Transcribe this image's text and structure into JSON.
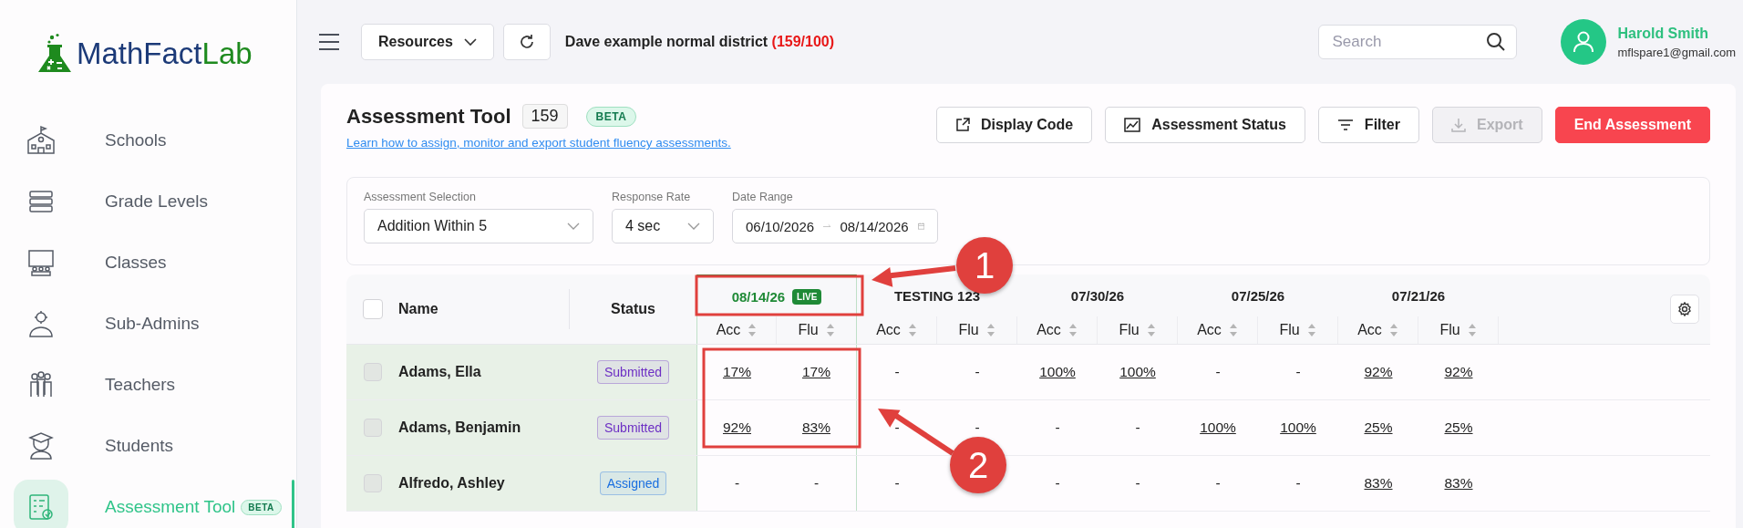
{
  "logo": {
    "part_1": "MathFact",
    "part_2": "Lab"
  },
  "sidebar": {
    "items": [
      {
        "label": "Schools",
        "kind": "school",
        "selected": false
      },
      {
        "label": "Grade Levels",
        "kind": "levels",
        "selected": false
      },
      {
        "label": "Classes",
        "kind": "classroom",
        "selected": false
      },
      {
        "label": "Sub-Admins",
        "kind": "admin",
        "selected": false
      },
      {
        "label": "Teachers",
        "kind": "teachers",
        "selected": false
      },
      {
        "label": "Students",
        "kind": "student",
        "selected": false
      },
      {
        "label": "Assessment Tool",
        "kind": "assessment",
        "selected": true,
        "badge": "BETA"
      }
    ]
  },
  "topbar": {
    "resources": "Resources",
    "district": "Dave example normal district",
    "district_count": "(159/100)",
    "search": {
      "placeholder": "Search"
    },
    "user": {
      "name": "Harold Smith",
      "email": "mflspare1@gmail.com"
    }
  },
  "page": {
    "title": "Assessment Tool",
    "count": "159",
    "badge": "BETA",
    "help_link": "Learn how to assign, monitor and export student fluency assessments.",
    "buttons": [
      {
        "label": "Display Code",
        "kind": "display",
        "disabled": false
      },
      {
        "label": "Assessment Status",
        "kind": "status",
        "disabled": false
      },
      {
        "label": "Filter",
        "kind": "filter",
        "disabled": false
      },
      {
        "label": "Export",
        "kind": "export",
        "disabled": true
      },
      {
        "label": "End Assessment",
        "kind": "end",
        "disabled": false
      }
    ]
  },
  "filters": {
    "assessment_selection": {
      "label": "Assessment Selection",
      "value": "Addition Within 5"
    },
    "response_rate": {
      "label": "Response Rate",
      "value": "4 sec"
    },
    "date_range": {
      "label": "Date Range",
      "start": "06/10/2026",
      "end": "08/14/2026"
    }
  },
  "table": {
    "select_all": {
      "checked": false
    },
    "columns": {
      "name": "Name",
      "status": "Status"
    },
    "sessions": [
      {
        "title": "08/14/26",
        "live": true,
        "live_label": "LIVE",
        "sub": [
          "Acc",
          "Flu"
        ]
      },
      {
        "title": "TESTING 123",
        "live": false,
        "sub": [
          "Acc",
          "Flu"
        ]
      },
      {
        "title": "07/30/26",
        "live": false,
        "sub": [
          "Acc",
          "Flu"
        ]
      },
      {
        "title": "07/25/26",
        "live": false,
        "sub": [
          "Acc",
          "Flu"
        ]
      },
      {
        "title": "07/21/26",
        "live": false,
        "sub": [
          "Acc",
          "Flu"
        ]
      }
    ],
    "rows": [
      {
        "checked": false,
        "name": "Adams, Ella",
        "status": {
          "label": "Submitted",
          "color": "#6d2fc4"
        },
        "cells": [
          {
            "text": "17%",
            "link": true
          },
          {
            "text": "17%",
            "link": true
          },
          {
            "text": "-",
            "link": false
          },
          {
            "text": "-",
            "link": false
          },
          {
            "text": "100%",
            "link": true
          },
          {
            "text": "100%",
            "link": true
          },
          {
            "text": "-",
            "link": false
          },
          {
            "text": "-",
            "link": false
          },
          {
            "text": "92%",
            "link": true
          },
          {
            "text": "92%",
            "link": true
          }
        ]
      },
      {
        "checked": false,
        "name": "Adams, Benjamin",
        "status": {
          "label": "Submitted",
          "color": "#6d2fc4"
        },
        "cells": [
          {
            "text": "92%",
            "link": true
          },
          {
            "text": "83%",
            "link": true
          },
          {
            "text": "-",
            "link": false
          },
          {
            "text": "-",
            "link": false
          },
          {
            "text": "-",
            "link": false
          },
          {
            "text": "-",
            "link": false
          },
          {
            "text": "100%",
            "link": true
          },
          {
            "text": "100%",
            "link": true
          },
          {
            "text": "25%",
            "link": true
          },
          {
            "text": "25%",
            "link": true
          }
        ]
      },
      {
        "checked": false,
        "name": "Alfredo, Ashley",
        "status": {
          "label": "Assigned",
          "color": "#1a6fe0"
        },
        "cells": [
          {
            "text": "-",
            "link": false
          },
          {
            "text": "-",
            "link": false
          },
          {
            "text": "-",
            "link": false
          },
          null,
          {
            "text": "-",
            "link": false
          },
          {
            "text": "-",
            "link": false
          },
          {
            "text": "-",
            "link": false
          },
          {
            "text": "-",
            "link": false
          },
          {
            "text": "83%",
            "link": true
          },
          {
            "text": "83%",
            "link": true
          }
        ]
      }
    ]
  },
  "annotations": [
    {
      "label": "1"
    },
    {
      "label": "2"
    }
  ]
}
